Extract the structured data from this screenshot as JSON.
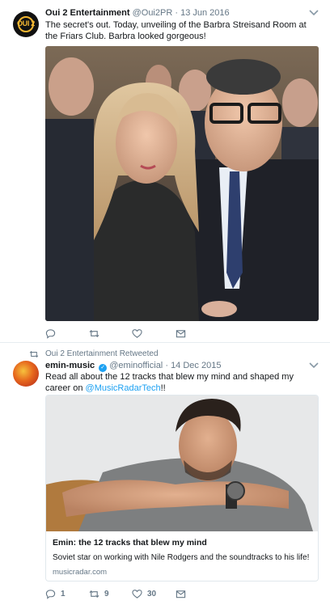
{
  "tweet1": {
    "avatar_text": "OUI 2",
    "name": "Oui 2 Entertainment",
    "handle": "@Oui2PR",
    "separator": "·",
    "date": "13 Jun 2016",
    "text": "The secret's out. Today, unveiling of the Barbra Streisand Room at the Friars Club. Barbra looked gorgeous!",
    "actions": {
      "reply_count": "",
      "retweet_count": "",
      "like_count": ""
    }
  },
  "tweet2": {
    "retweeted_by": "Oui 2 Entertainment Retweeted",
    "name": "emin-music",
    "handle": "@eminofficial",
    "separator": "·",
    "date": "14 Dec 2015",
    "text_before": "Read all about the 12 tracks that blew my mind and shaped my career on ",
    "mention": "@MusicRadarTech",
    "text_after": "!!",
    "card": {
      "title": "Emin: the 12 tracks that blew my mind",
      "description": "Soviet star on working with Nile Rodgers and the soundtracks to his life!",
      "domain": "musicradar.com"
    },
    "actions": {
      "reply_count": "1",
      "retweet_count": "9",
      "like_count": "30"
    }
  },
  "icons": {
    "reply": "reply-icon",
    "retweet": "retweet-icon",
    "like": "heart-icon",
    "message": "envelope-icon",
    "caret": "chevron-down-icon",
    "verified": "verified-badge-icon"
  },
  "colors": {
    "link": "#1da1f2",
    "muted": "#657786",
    "border": "#e6ecf0"
  }
}
